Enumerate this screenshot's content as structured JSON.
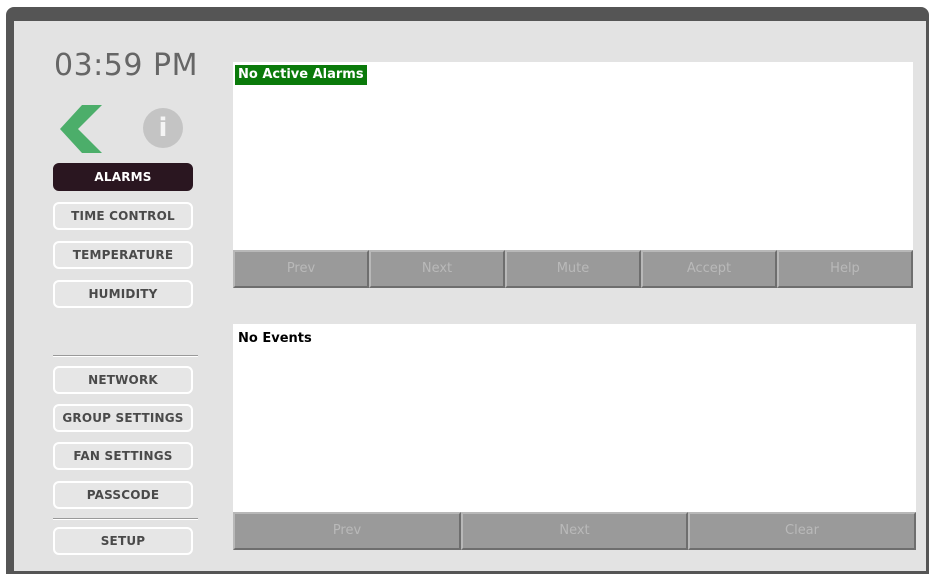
{
  "clock": {
    "time": "03:59 PM"
  },
  "icons": {
    "back": "back-arrow-icon",
    "info": "info-icon",
    "info_glyph": "i"
  },
  "sidebar": {
    "primary": [
      {
        "label": "ALARMS",
        "active": true
      },
      {
        "label": "TIME CONTROL",
        "active": false
      },
      {
        "label": "TEMPERATURE",
        "active": false
      },
      {
        "label": "HUMIDITY",
        "active": false
      }
    ],
    "secondary": [
      {
        "label": "NETWORK"
      },
      {
        "label": "GROUP SETTINGS"
      },
      {
        "label": "FAN SETTINGS"
      },
      {
        "label": "PASSCODE"
      }
    ],
    "setup": {
      "label": "SETUP"
    }
  },
  "alarms": {
    "status": "No Active Alarms",
    "buttons": [
      "Prev",
      "Next",
      "Mute",
      "Accept",
      "Help"
    ]
  },
  "events": {
    "status": "No Events",
    "buttons": [
      "Prev",
      "Next",
      "Clear"
    ]
  },
  "colors": {
    "accent_green": "#0a7a0a",
    "active_button": "#2a1620",
    "back_arrow": "#4cae6a"
  }
}
